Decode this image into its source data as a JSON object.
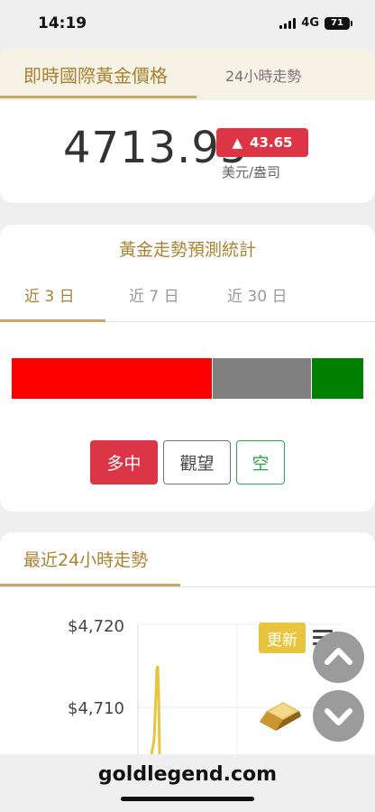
{
  "status": {
    "time": "14:19",
    "network": "4G",
    "battery": "71"
  },
  "tabs": {
    "active": "即時國際黃金價格",
    "inactive": "24小時走勢"
  },
  "price": {
    "value": "4713.95",
    "arrow": "▲",
    "change": "43.65",
    "unit": "美元/盎司"
  },
  "forecast": {
    "title": "黃金走勢預測統計",
    "tabs": [
      "近 3 日",
      "近 7 日",
      "近 30 日"
    ],
    "bar": {
      "red": 0.57,
      "gray": 0.28,
      "green": 0.15
    },
    "buttons": {
      "bull": "多中",
      "watch": "觀望",
      "bear": "空"
    }
  },
  "trend": {
    "title": "最近24小時走勢",
    "y_ticks": [
      "$4,720",
      "$4,710"
    ]
  },
  "refresh_label": "更新",
  "footer": {
    "domain": "goldlegend.com"
  },
  "colors": {
    "accent": "#a98231",
    "up": "#dc3545",
    "bull": "#ff0000",
    "watch": "#808080",
    "bear": "#008000",
    "line": "#e8c53d"
  },
  "icons": [
    "signal-icon",
    "battery-icon",
    "menu-icon",
    "chevron-up-icon",
    "chevron-down-icon",
    "gold-bar-icon"
  ]
}
